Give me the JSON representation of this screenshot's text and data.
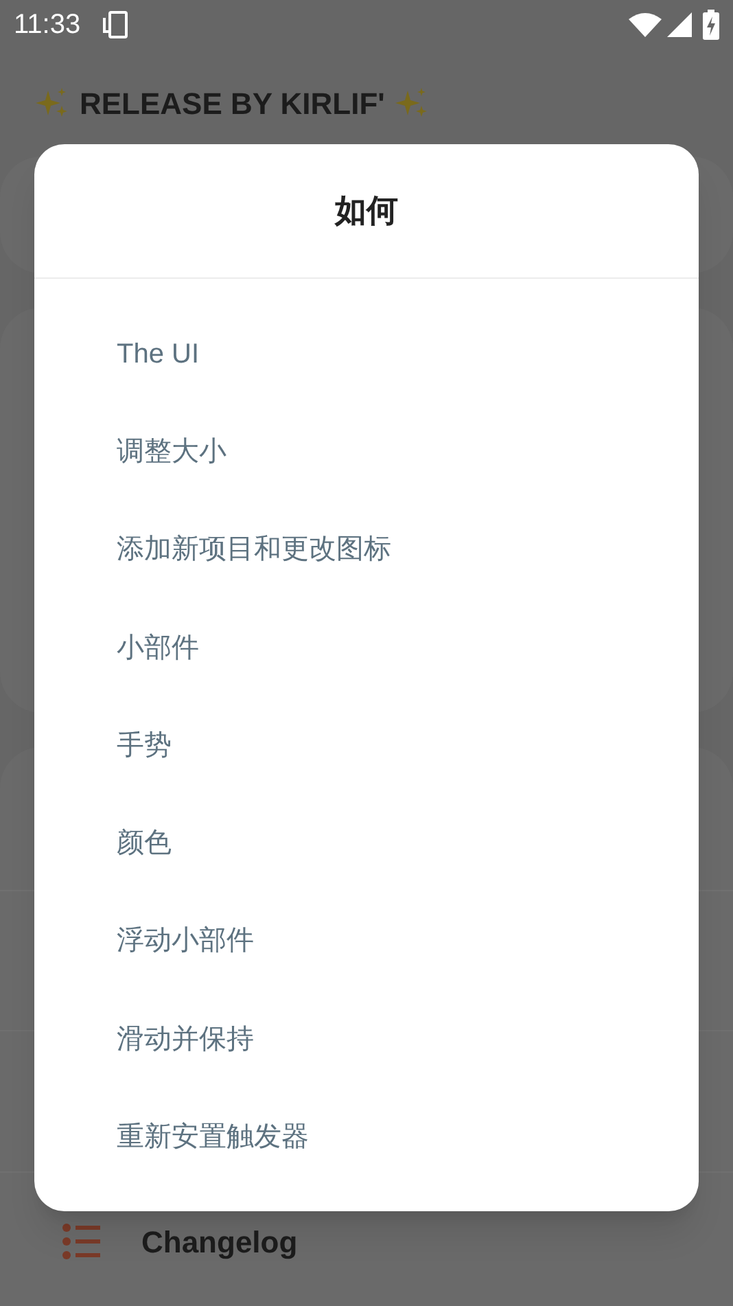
{
  "status_bar": {
    "time": "11:33"
  },
  "header": {
    "title": "RELEASE BY KIRLIF'"
  },
  "background_list": {
    "items": [
      {
        "label": "Changelog"
      }
    ]
  },
  "dialog": {
    "title": "如何",
    "items": [
      {
        "label": "The UI"
      },
      {
        "label": "调整大小"
      },
      {
        "label": "添加新项目和更改图标"
      },
      {
        "label": "小部件"
      },
      {
        "label": "手势"
      },
      {
        "label": "颜色"
      },
      {
        "label": "浮动小部件"
      },
      {
        "label": "滑动并保持"
      },
      {
        "label": "重新安置触发器"
      }
    ]
  }
}
